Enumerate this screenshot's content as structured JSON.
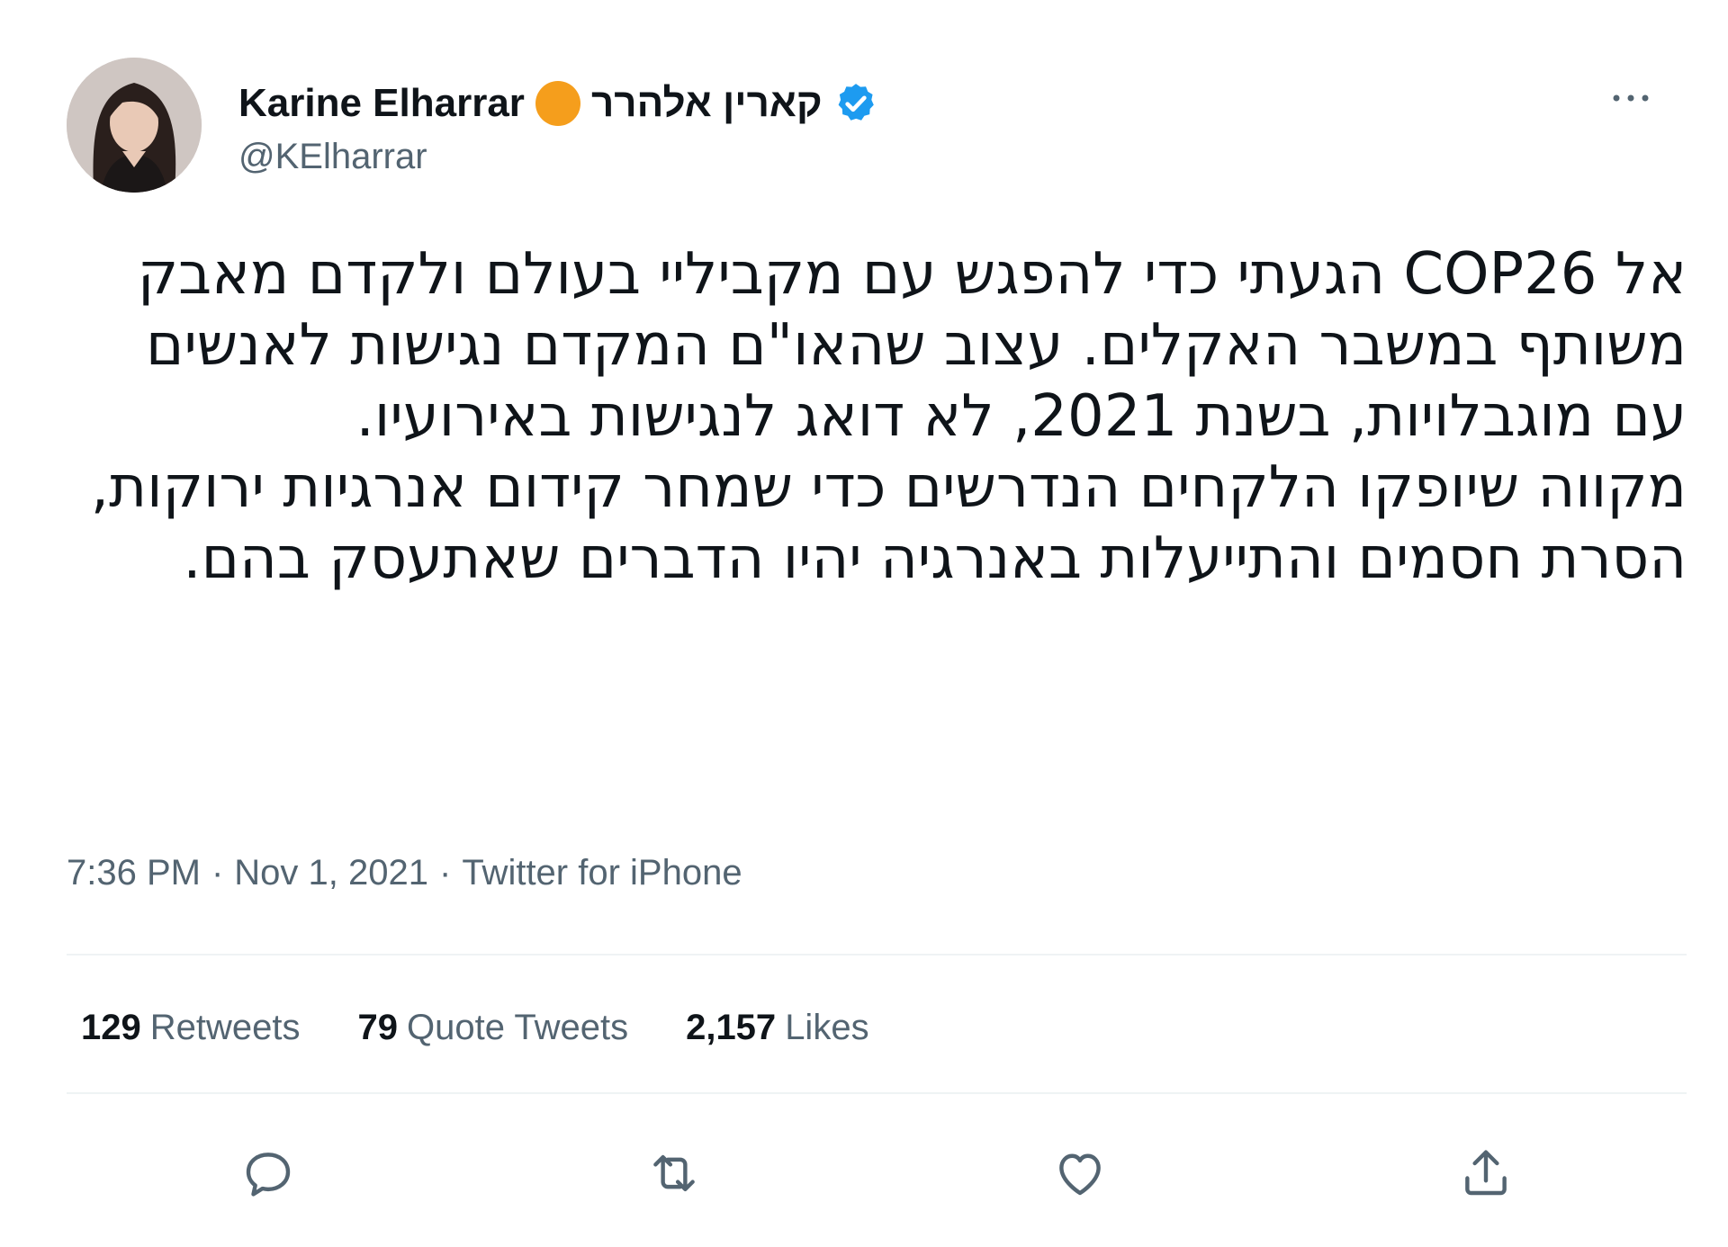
{
  "tweet": {
    "author": {
      "display_name": "Karine Elharrar",
      "display_name_hebrew": "קארין אלהרר",
      "handle": "@KElharrar",
      "emoji_icon": "orange-circle-emoji",
      "verified_icon": "verified-badge-icon"
    },
    "menu_icon": "more-options-icon",
    "text_paragraphs": [
      "אל COP26 הגעתי כדי להפגש עם מקביליי בעולם ולקדם מאבק משותף במשבר האקלים. עצוב שהאו\"ם המקדם נגישות לאנשים עם מוגבלויות, בשנת 2021, לא דואג לנגישות באירועיו.",
      "מקווה שיופקו הלקחים הנדרשים כדי שמחר קידום אנרגיות ירוקות, הסרת חסמים והתייעלות באנרגיה יהיו הדברים שאתעסק בהם."
    ],
    "meta": {
      "time": "7:36 PM",
      "date": "Nov 1, 2021",
      "source": "Twitter for iPhone",
      "separator": "·"
    },
    "stats": {
      "retweets_count": "129",
      "retweets_label": "Retweets",
      "quote_tweets_count": "79",
      "quote_tweets_label": "Quote Tweets",
      "likes_count": "2,157",
      "likes_label": "Likes"
    },
    "actions": [
      "reply-icon",
      "retweet-icon",
      "like-icon",
      "share-icon"
    ],
    "colors": {
      "text": "#0f1419",
      "secondary": "#536471",
      "verified": "#1d9bf0",
      "emoji": "#f59e1c",
      "divider": "#eff3f4"
    }
  }
}
